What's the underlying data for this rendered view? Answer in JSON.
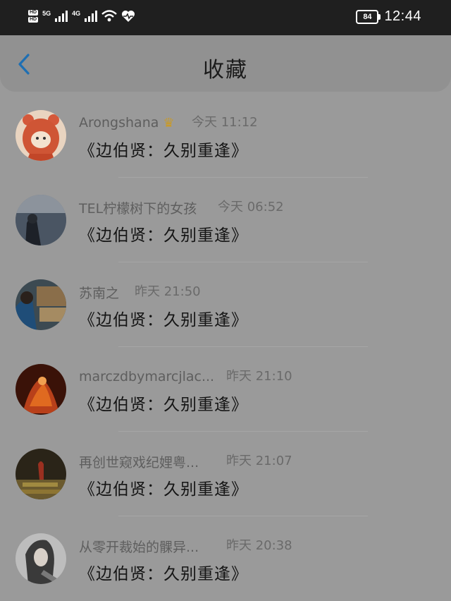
{
  "status_bar": {
    "hd_labels": [
      "HD",
      "HD"
    ],
    "network_1": "5G",
    "network_2": "4G",
    "battery": "84",
    "time": "12:44"
  },
  "header": {
    "title": "收藏",
    "back_icon": "chevron-left-icon",
    "accent": "#1e6fb3"
  },
  "items": [
    {
      "user": "Arongshana",
      "badge": "crown-icon",
      "time": "今天 11:12",
      "title": "《边伯贤：久别重逢》"
    },
    {
      "user": "TEL柠檬树下的女孩",
      "time": "今天 06:52",
      "title": "《边伯贤：久别重逢》"
    },
    {
      "user": "苏南之",
      "time": "昨天 21:50",
      "title": "《边伯贤：久别重逢》"
    },
    {
      "user": "marczdbymarcjlac...",
      "time": "昨天 21:10",
      "title": "《边伯贤：久别重逢》"
    },
    {
      "user": "再创世窥戏纪娌粤...",
      "time": "昨天 21:07",
      "title": "《边伯贤：久别重逢》"
    },
    {
      "user": "从零开裁始的髁异...",
      "time": "昨天 20:38",
      "title": "《边伯贤：久别重逢》"
    }
  ]
}
